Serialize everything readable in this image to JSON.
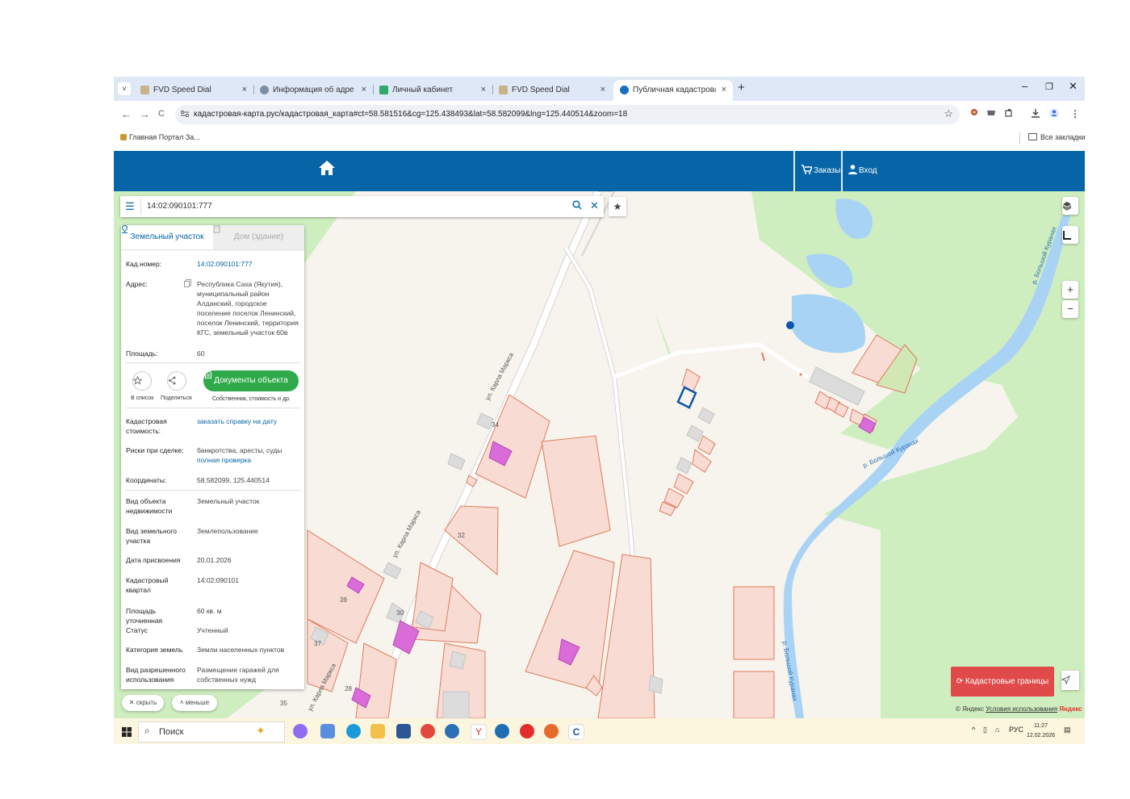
{
  "browser": {
    "tabs": [
      {
        "title": "FVD Speed Dial",
        "close": "×",
        "active": false
      },
      {
        "title": "Информация об адресе",
        "close": "×",
        "active": false
      },
      {
        "title": "Личный кабинет",
        "close": "×",
        "active": false
      },
      {
        "title": "FVD Speed Dial",
        "close": "×",
        "active": false
      },
      {
        "title": "Публичная кадастровая карта",
        "close": "×",
        "active": true
      }
    ],
    "tab_menu": "˅",
    "new_tab": "+",
    "window_controls": {
      "minimize": "–",
      "restore": "❐",
      "close": "✕"
    },
    "nav": {
      "back": "←",
      "forward": "→",
      "reload": "C"
    },
    "url": "кадастровая-карта.рус/кадастровая_карта#ct=58.581516&cg=125.438493&lat=58.582099&lng=125.440514&zoom=18",
    "bookmark_star": "☆",
    "bookmarks": {
      "left": "Главная Портал За...",
      "right": "Все закладки"
    }
  },
  "app_header": {
    "orders_label": "Заказы",
    "login_label": "Вход",
    "accent": "#0565a6"
  },
  "search": {
    "value": "14:02:090101:777",
    "menu_icon": "☰",
    "search_icon": "Q",
    "clear_icon": "✕",
    "star_icon": "★"
  },
  "panel": {
    "tab_land": "Земельный участок",
    "tab_house": "Дом (здание)",
    "cad_number": {
      "label": "Кад.номер:",
      "value": "14:02:090101:777"
    },
    "address": {
      "label": "Адрес:",
      "value": "Республика Саха (Якутия), муниципальный район Алданский, городское поселение поселок Ленинский, поселок Ленинский, территория КГС, земельный участок 60в"
    },
    "area": {
      "label": "Площадь:",
      "value": "60"
    },
    "actions": {
      "to_list": "В список",
      "share": "Поделиться",
      "docs_button": "Документы объекта",
      "docs_note": "Собственник, стоимость и др."
    },
    "cad_value": {
      "label": "Кадастровая стоимость:",
      "value": "заказать справку на дату"
    },
    "risks": {
      "label": "Риски при сделке:",
      "value": "банкротства, аресты, суды",
      "link": "полная проверка"
    },
    "coords": {
      "label": "Координаты:",
      "value": "58.582099, 125.440514"
    },
    "details": [
      {
        "label": "Вид объекта недвижимости",
        "value": "Земельный участок"
      },
      {
        "label": "Вид земельного участка",
        "value": "Землепользование"
      },
      {
        "label": "Дата присвоения",
        "value": "20.01.2026"
      },
      {
        "label": "Кадастровый квартал",
        "value": "14:02:090101"
      },
      {
        "label": "Площадь уточненная",
        "value": "60 кв. м"
      },
      {
        "label": "Статус",
        "value": "Учтенный"
      },
      {
        "label": "Категория земель",
        "value": "Земли населенных пунктов"
      },
      {
        "label": "Вид разрешенного использования",
        "value": "Размещение гаражей для собственных нужд"
      }
    ],
    "hide_button": "скрыть",
    "less_button": "меньше"
  },
  "map": {
    "street_labels": [
      "ул. Карла Маркса",
      "ул. Карла Маркса",
      "ул. Карла Маркса"
    ],
    "river_labels": [
      "р. Большой Куранах",
      "р. Большой Куранах",
      "р. Большой Куранах"
    ],
    "house_numbers": [
      "34",
      "32",
      "39",
      "30",
      "37",
      "28",
      "35"
    ],
    "zoom_in": "+",
    "zoom_out": "−",
    "cadastre_button": "Кадастровые границы",
    "attribution": {
      "copyright": "© Яндекс",
      "terms": "Условия использования",
      "brand": "Яндекс"
    }
  },
  "taskbar": {
    "search_placeholder": "Поиск",
    "language": "РУС",
    "time": "11:27",
    "date": "12.02.2026"
  }
}
